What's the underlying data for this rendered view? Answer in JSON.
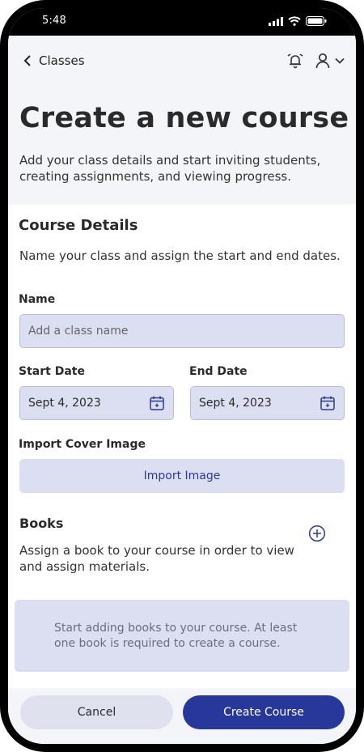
{
  "status_bar": {
    "time": "5:48"
  },
  "nav": {
    "back_label": "Classes"
  },
  "header": {
    "title": "Create a new course",
    "subtitle": "Add your class details and start inviting students, creating assignments, and viewing progress."
  },
  "course_details": {
    "title": "Course Details",
    "description": "Name your class and assign the start and end dates."
  },
  "name_field": {
    "label": "Name",
    "placeholder": "Add a class name"
  },
  "start_date": {
    "label": "Start Date",
    "value": "Sept 4, 2023"
  },
  "end_date": {
    "label": "End Date",
    "value": "Sept 4, 2023"
  },
  "cover_image": {
    "label": "Import Cover Image",
    "button_label": "Import Image"
  },
  "books": {
    "title": "Books",
    "description": "Assign a book to your course in order to view and assign materials.",
    "empty_message": "Start adding books to your course. At least one book is required to create a course."
  },
  "footer": {
    "cancel_label": "Cancel",
    "create_label": "Create Course"
  },
  "colors": {
    "accent": "#27379a",
    "input_bg": "#dcdff1",
    "header_bg": "#f4f5f8"
  }
}
